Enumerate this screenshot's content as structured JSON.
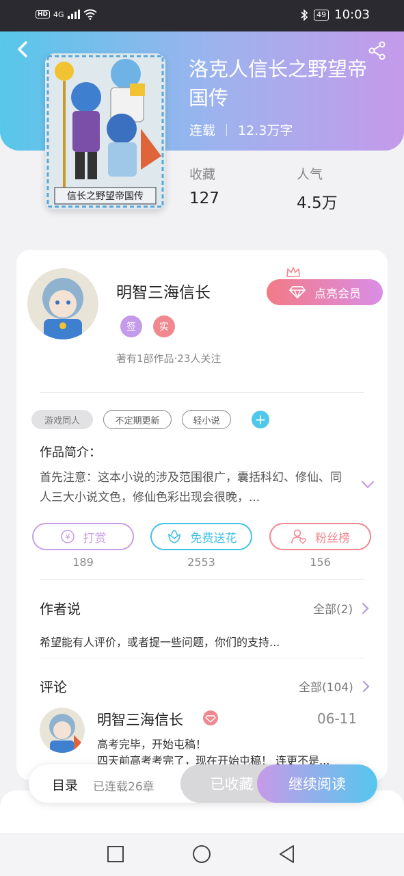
{
  "status_bar": {
    "hd": "HD",
    "network": "4G",
    "battery": "49",
    "time": "10:03"
  },
  "header": {
    "title": "洛克人信长之野望帝国传",
    "status": "连载",
    "word_count": "12.3万字",
    "stats": [
      {
        "label": "收藏",
        "value": "127"
      },
      {
        "label": "人气",
        "value": "4.5万"
      }
    ]
  },
  "author": {
    "name": "明智三海信长",
    "vip_label": "点亮会员",
    "badges": [
      "签",
      "实"
    ],
    "meta": "著有1部作品·23人关注"
  },
  "tags": [
    "游戏同人",
    "不定期更新",
    "轻小说"
  ],
  "tag_add": "+",
  "intro": {
    "label": "作品简介：",
    "text": "首先注意：这本小说的涉及范围很广，囊括科幻、修仙、同人三大小说文色，修仙色彩出现会很晚，..."
  },
  "actions": [
    {
      "label": "打赏",
      "count": "189",
      "icon": "coin-icon",
      "color": "#c99ee6"
    },
    {
      "label": "免费送花",
      "count": "2553",
      "icon": "flower-icon",
      "color": "#45c0e6"
    },
    {
      "label": "粉丝榜",
      "count": "156",
      "icon": "fan-icon",
      "color": "#f08890"
    }
  ],
  "author_say": {
    "title": "作者说",
    "more": "全部(2)",
    "text": "希望能有人评价，或者提一些问题，你们的支持..."
  },
  "comments": {
    "title": "评论",
    "more": "全部(104)",
    "items": [
      {
        "user": "明智三海信长",
        "date": "06-11",
        "line1": "高考完毕，开始屯稿！",
        "line2": "四天前高考考完了，现在开始屯稿！ 连更不是..."
      }
    ]
  },
  "bottom_bar": {
    "toc": "目录",
    "chapters": "已连载26章",
    "collected": "已收藏",
    "continue": "继续阅读"
  },
  "colors": {
    "header_start": "#57c7ea",
    "header_end": "#c49aea",
    "vip_start": "#f37a86",
    "accent_blue": "#50c8ea"
  }
}
